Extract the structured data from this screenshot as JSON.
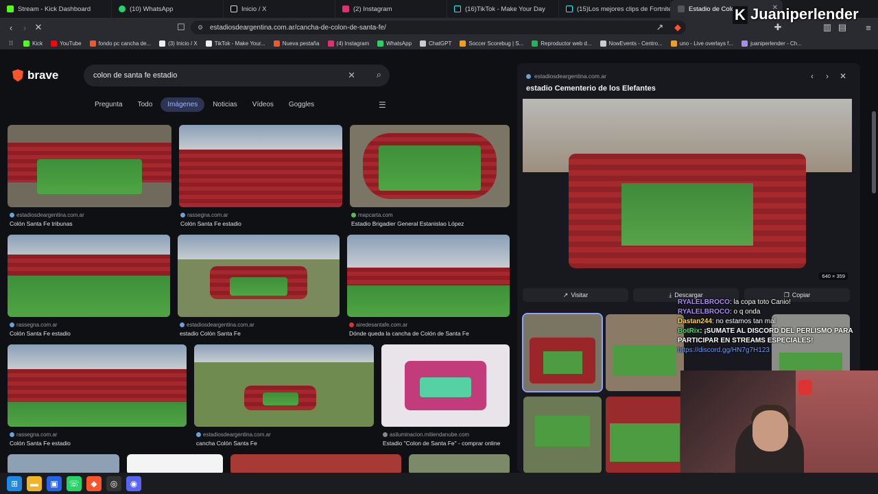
{
  "tabs": [
    {
      "title": "Stream - Kick Dashboard",
      "color": "#53fc18"
    },
    {
      "title": "(10) WhatsApp",
      "color": "#25d366"
    },
    {
      "title": "Inicio / X",
      "color": "#ffffff"
    },
    {
      "title": "(2) Instagram",
      "color": "#e1306c"
    },
    {
      "title": "(16)TikTok - Make Your Day",
      "color": "#ffffff"
    },
    {
      "title": "(15)Los mejores clips de Fortnite y co",
      "color": "#ffffff"
    },
    {
      "title": "Estadio de Colón d",
      "color": "#fb542b",
      "active": true
    }
  ],
  "address": {
    "url": "estadiosdeargentina.com.ar/cancha-de-colon-de-santa-fe/"
  },
  "bookmarks": [
    {
      "label": "Kick",
      "color": "#53fc18"
    },
    {
      "label": "YouTube",
      "color": "#ff0000"
    },
    {
      "label": "fondo pc cancha de...",
      "color": "#fb542b"
    },
    {
      "label": "(3) Inicio / X",
      "color": "#ffffff"
    },
    {
      "label": "TikTok - Make Your...",
      "color": "#ffffff"
    },
    {
      "label": "Nueva pestaña",
      "color": "#fb542b"
    },
    {
      "label": "(4) Instagram",
      "color": "#e1306c"
    },
    {
      "label": "WhatsApp",
      "color": "#25d366"
    },
    {
      "label": "ChatGPT",
      "color": "#cccccc"
    },
    {
      "label": "Soccer Scorebug | S...",
      "color": "#f0a020"
    },
    {
      "label": "Reproductor web d...",
      "color": "#1db954"
    },
    {
      "label": "NowEvents - Centro...",
      "color": "#cccccc"
    },
    {
      "label": "uno - Live overlays f...",
      "color": "#f0a020"
    },
    {
      "label": "juaniperlender - Ch...",
      "color": "#a88cf0"
    }
  ],
  "search": {
    "brand": "brave",
    "query": "colon de santa fe estadio",
    "tabs": [
      "Pregunta",
      "Todo",
      "Imágenes",
      "Noticias",
      "Vídeos",
      "Goggles"
    ],
    "selected_tab": "Imágenes"
  },
  "results": [
    {
      "source": "estadiosdeargentina.com.ar",
      "caption": "Colón Santa Fe tribunas"
    },
    {
      "source": "rassegna.com.ar",
      "caption": "Colón Santa Fe estadio"
    },
    {
      "source": "mapcarta.com",
      "caption": "Estadio Brigadier General Estanislao López"
    },
    {
      "source": "rassegna.com.ar",
      "caption": "Colón Santa Fe estadio"
    },
    {
      "source": "estadiosdeargentina.com.ar",
      "caption": "estadio Colón Santa Fe"
    },
    {
      "source": "airedesantafe.com.ar",
      "caption": "Dónde queda la cancha de Colón de Santa Fe"
    },
    {
      "source": "rassegna.com.ar",
      "caption": "Colón Santa Fe estadio"
    },
    {
      "source": "estadiosdeargentina.com.ar",
      "caption": "cancha Colón Santa Fe"
    },
    {
      "source": "asiluminacion.mitiendanube.com",
      "caption": "Estadio \"Colon de Santa Fe\" - comprar online"
    }
  ],
  "preview": {
    "source": "estadiosdeargentina.com.ar",
    "title": "estadio Cementerio de los Elefantes",
    "dimensions": "640 × 359",
    "buttons": [
      "Visitar",
      "Descargar",
      "Copiar"
    ]
  },
  "chat": [
    {
      "user": "RYALELBROCO",
      "text": ": la copa toto Canio!"
    },
    {
      "user": "RYALELBROCO",
      "text": ": o q onda"
    },
    {
      "user": "Dastan244",
      "text": ": no estamos tan mal"
    },
    {
      "user": "BotRix",
      "text": ": ¡SUMATE AL DISCORD DEL PERLISMO PARA"
    },
    {
      "user": "",
      "text": "PARTICIPAR EN STREAMS ESPECIALES!"
    },
    {
      "user": "",
      "text": "https://discord.gg/HN7g7H123"
    }
  ],
  "overlay": {
    "streamer": "Juaniperlender"
  }
}
